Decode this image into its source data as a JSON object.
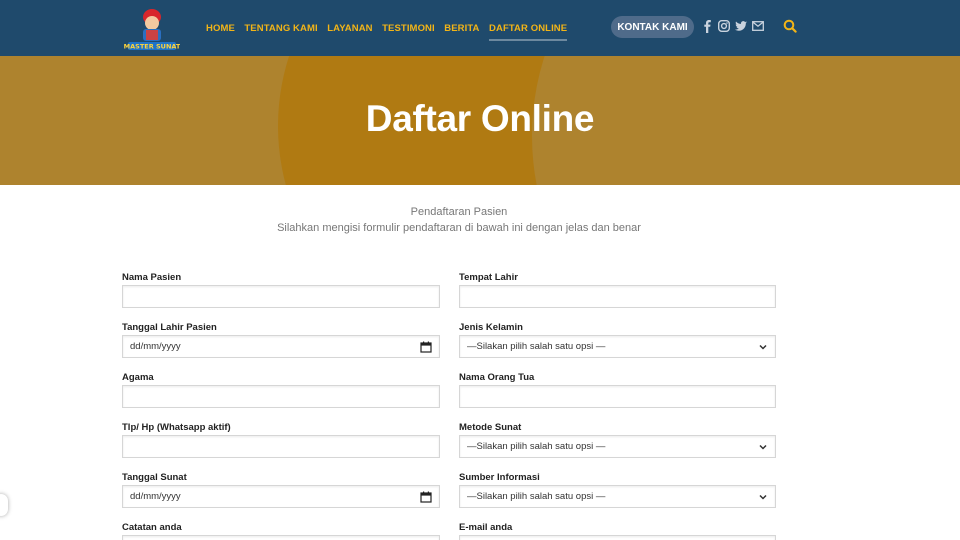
{
  "header": {
    "logo_text": "MASTER SUNAT",
    "nav": [
      "HOME",
      "TENTANG KAMI",
      "LAYANAN",
      "TESTIMONI",
      "BERITA",
      "DAFTAR ONLINE"
    ],
    "contact_button": "KONTAK KAMI",
    "social_icons": [
      "facebook-icon",
      "instagram-icon",
      "twitter-icon",
      "mail-icon"
    ],
    "colors": {
      "bar": "#1f4a6c",
      "nav_text": "#f2b417"
    }
  },
  "hero": {
    "title": "Daftar Online",
    "color": "#ae832e"
  },
  "intro": {
    "line1": "Pendaftaran Pasien",
    "line2": "Silahkan mengisi formulir pendaftaran di bawah ini dengan jelas dan benar"
  },
  "form": {
    "left": [
      {
        "label": "Nama Pasien",
        "type": "text",
        "value": ""
      },
      {
        "label": "Tanggal Lahir Pasien",
        "type": "date",
        "value": "dd/mm/yyyy"
      },
      {
        "label": "Agama",
        "type": "text",
        "value": ""
      },
      {
        "label": "Tlp/ Hp (Whatsapp aktif)",
        "type": "text",
        "value": ""
      },
      {
        "label": "Tanggal Sunat",
        "type": "date",
        "value": "dd/mm/yyyy"
      },
      {
        "label": "Catatan anda",
        "type": "text",
        "value": ""
      }
    ],
    "right": [
      {
        "label": "Tempat Lahir",
        "type": "text",
        "value": ""
      },
      {
        "label": "Jenis Kelamin",
        "type": "select",
        "value": "—Silakan pilih salah satu opsi —"
      },
      {
        "label": "Nama Orang Tua",
        "type": "text",
        "value": ""
      },
      {
        "label": "Metode Sunat",
        "type": "select",
        "value": "—Silakan pilih salah satu opsi —"
      },
      {
        "label": "Sumber Informasi",
        "type": "select",
        "value": "—Silakan pilih salah satu opsi —"
      },
      {
        "label": "E-mail anda",
        "type": "text",
        "value": ""
      }
    ]
  }
}
